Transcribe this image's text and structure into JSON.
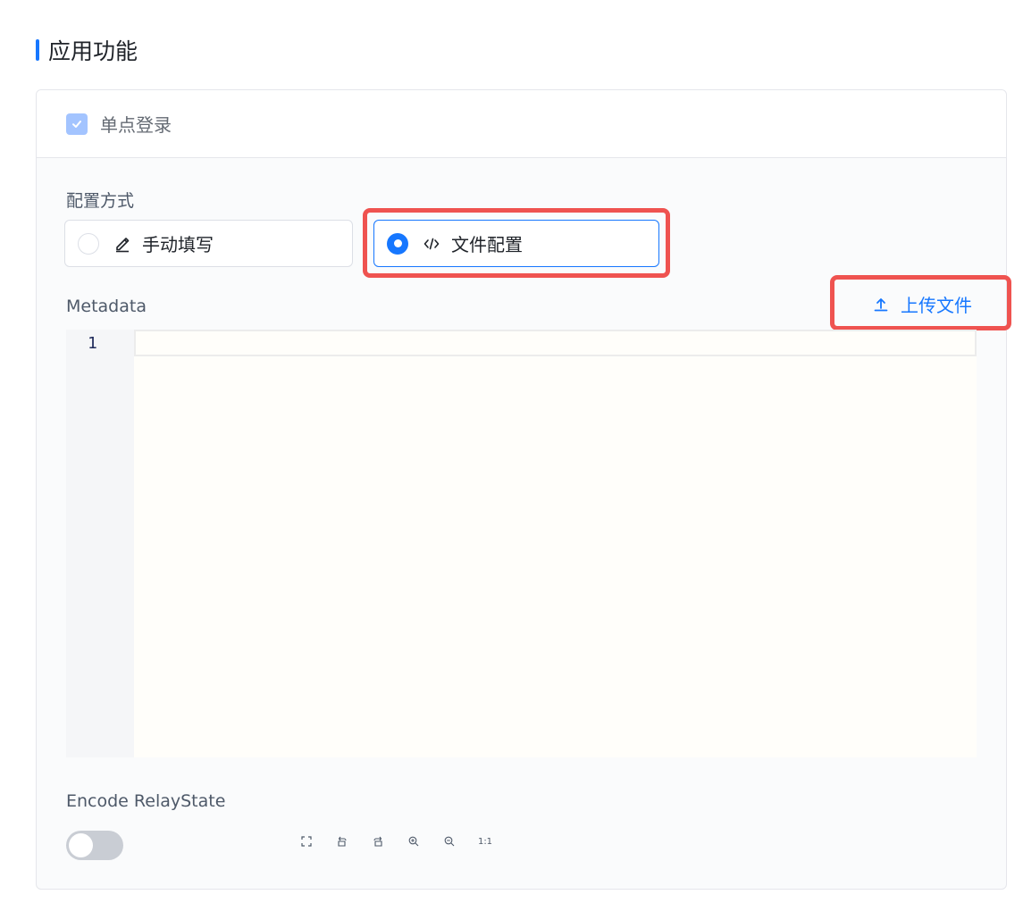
{
  "section": {
    "title": "应用功能"
  },
  "sso": {
    "label": "单点登录",
    "checked": true
  },
  "config": {
    "label": "配置方式",
    "options": [
      {
        "label": "手动填写",
        "icon": "edit-icon",
        "selected": false
      },
      {
        "label": "文件配置",
        "icon": "code-icon",
        "selected": true
      }
    ]
  },
  "metadata": {
    "label": "Metadata",
    "upload_label": "上传文件",
    "lines": [
      "1"
    ]
  },
  "relay_state": {
    "label": "Encode RelayState",
    "enabled": false
  },
  "toolbar": {
    "tools": [
      {
        "icon": "fullscreen-icon"
      },
      {
        "icon": "rotate-left-icon"
      },
      {
        "icon": "rotate-right-icon"
      },
      {
        "icon": "zoom-in-icon"
      },
      {
        "icon": "zoom-out-icon"
      },
      {
        "label": "1:1"
      }
    ]
  },
  "colors": {
    "primary": "#1677ff",
    "highlight": "#ef5350",
    "checkbox": "#a3c4ff"
  }
}
